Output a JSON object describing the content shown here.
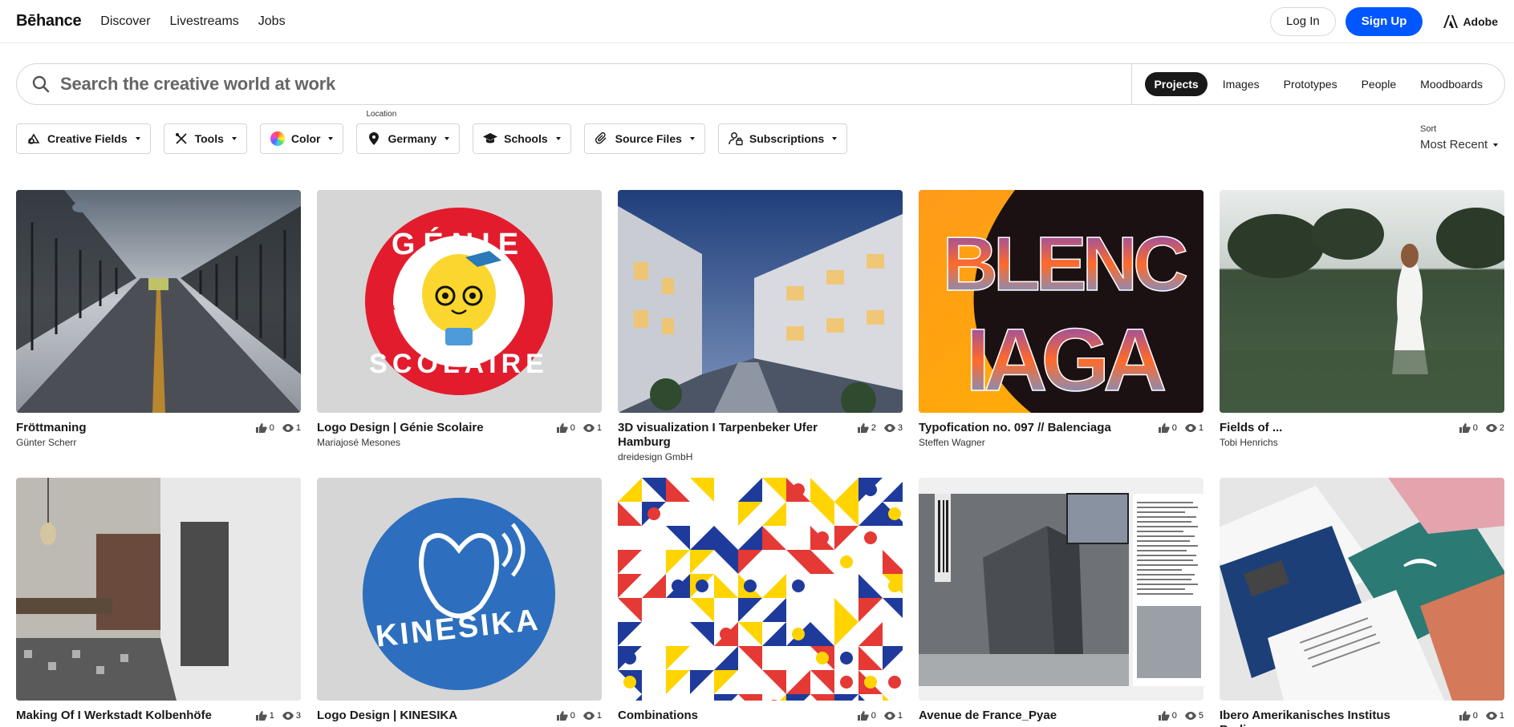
{
  "nav": {
    "logo": "Bēhance",
    "links": [
      "Discover",
      "Livestreams",
      "Jobs"
    ],
    "login": "Log In",
    "signup": "Sign Up",
    "adobe": "Adobe"
  },
  "search": {
    "placeholder": "Search the creative world at work",
    "tabs": [
      "Projects",
      "Images",
      "Prototypes",
      "People",
      "Moodboards"
    ],
    "active_tab": "Projects"
  },
  "filters": {
    "creative_fields": "Creative Fields",
    "tools": "Tools",
    "color": "Color",
    "location_label": "Location",
    "location": "Germany",
    "schools": "Schools",
    "source_files": "Source Files",
    "subscriptions": "Subscriptions"
  },
  "sort": {
    "label": "Sort",
    "value": "Most Recent"
  },
  "colors": {
    "accent": "#0057ff",
    "text": "#191919"
  },
  "projects": [
    {
      "title": "Fröttmaning",
      "owner": "Günter Scherr",
      "likes": "0",
      "views": "1"
    },
    {
      "title": "Logo Design | Génie Scolaire",
      "owner": "Mariajosé Mesones",
      "likes": "0",
      "views": "1"
    },
    {
      "title": "3D visualization I Tarpenbeker Ufer Hamburg",
      "owner": "dreidesign GmbH",
      "likes": "2",
      "views": "3"
    },
    {
      "title": "Typofication no. 097 // Balenciaga",
      "owner": "Steffen Wagner",
      "likes": "0",
      "views": "1"
    },
    {
      "title": "Fields of ...",
      "owner": "Tobi Henrichs",
      "likes": "0",
      "views": "2"
    },
    {
      "title": "Making Of I Werkstadt Kolbenhöfe",
      "owner": "",
      "likes": "1",
      "views": "3"
    },
    {
      "title": "Logo Design | KINESIKA",
      "owner": "",
      "likes": "0",
      "views": "1"
    },
    {
      "title": "Combinations",
      "owner": "",
      "likes": "0",
      "views": "1"
    },
    {
      "title": "Avenue de France_Pyae",
      "owner": "",
      "likes": "0",
      "views": "5"
    },
    {
      "title": "Ibero Amerikanisches Institus Berlin",
      "owner": "",
      "likes": "0",
      "views": "1"
    }
  ],
  "thumb_text": {
    "genie_top": "GÉNIE",
    "genie_bottom": "SCOLAIRE",
    "kinesika": "KINESIKA",
    "balenciaga_top": "BLENC",
    "balenciaga_bottom": "IAGA"
  }
}
